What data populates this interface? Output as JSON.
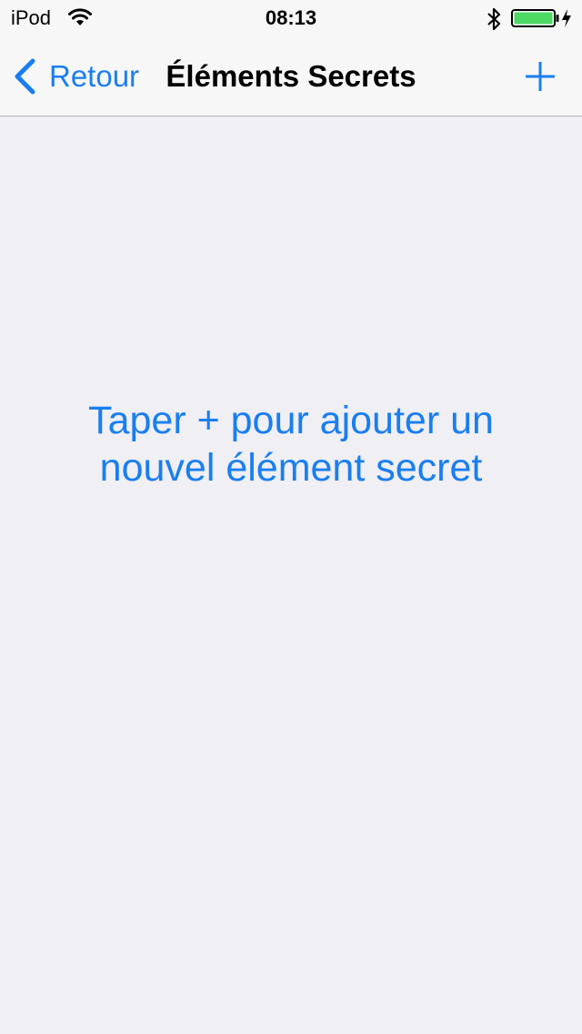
{
  "status_bar": {
    "carrier": "iPod",
    "time": "08:13",
    "icons": [
      "wifi-icon",
      "bluetooth-icon",
      "battery-icon",
      "charging-icon"
    ],
    "battery_level": 1.0
  },
  "nav": {
    "back_label": "Retour",
    "title": "Éléments Secrets",
    "add_icon": "plus-icon"
  },
  "main": {
    "empty_message": "Taper + pour ajouter un nouvel élément secret"
  },
  "colors": {
    "accent": "#1a7ef0",
    "background": "#efeff4",
    "nav_background": "#f7f7f7",
    "battery_fill": "#4cd964"
  }
}
